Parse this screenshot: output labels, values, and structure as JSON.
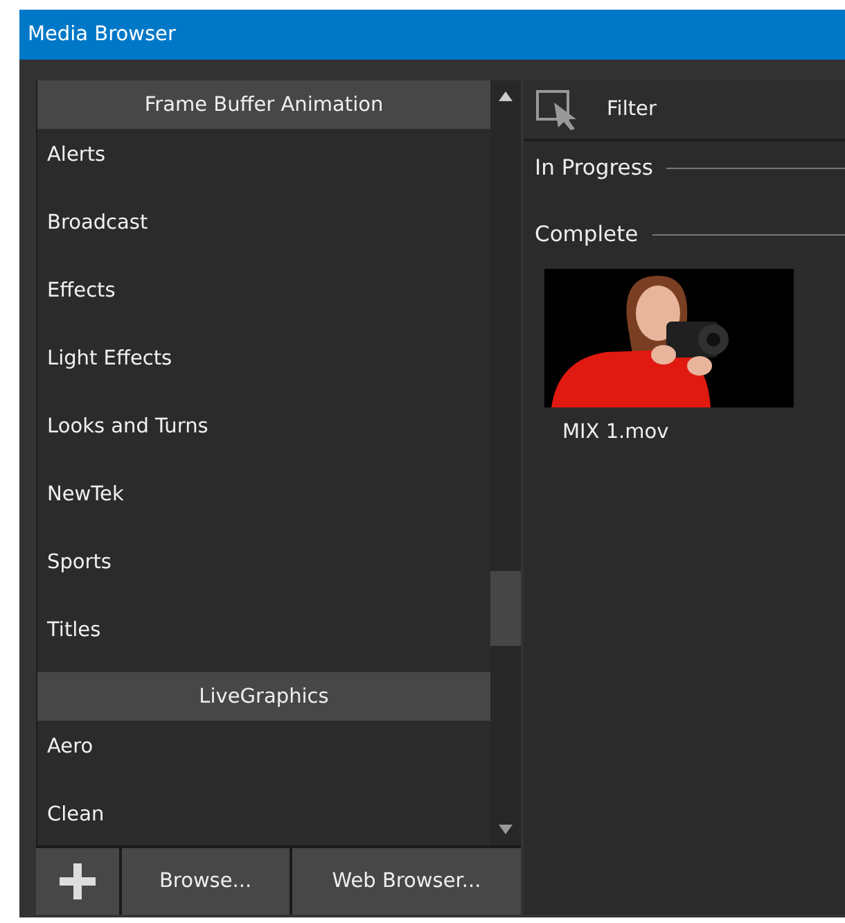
{
  "window": {
    "title": "Media Browser"
  },
  "categories": [
    {
      "kind": "header",
      "label": "Frame Buffer Animation"
    },
    {
      "kind": "item",
      "label": "Alerts"
    },
    {
      "kind": "item",
      "label": "Broadcast"
    },
    {
      "kind": "item",
      "label": "Effects"
    },
    {
      "kind": "item",
      "label": "Light Effects"
    },
    {
      "kind": "item",
      "label": "Looks and Turns"
    },
    {
      "kind": "item",
      "label": "NewTek"
    },
    {
      "kind": "item",
      "label": "Sports"
    },
    {
      "kind": "item",
      "label": "Titles"
    },
    {
      "kind": "header",
      "label": "LiveGraphics"
    },
    {
      "kind": "item",
      "label": "Aero"
    },
    {
      "kind": "item",
      "label": "Clean"
    }
  ],
  "buttons": [
    {
      "kind": "add"
    },
    {
      "kind": "text",
      "label": "Browse..."
    },
    {
      "kind": "text",
      "label": "Web Browser..."
    }
  ],
  "filter": {
    "label": "Filter"
  },
  "sections": [
    {
      "title": "In Progress"
    },
    {
      "title": "Complete",
      "items": [
        {
          "name": "MIX 1.mov",
          "kind": "picture"
        }
      ]
    }
  ]
}
